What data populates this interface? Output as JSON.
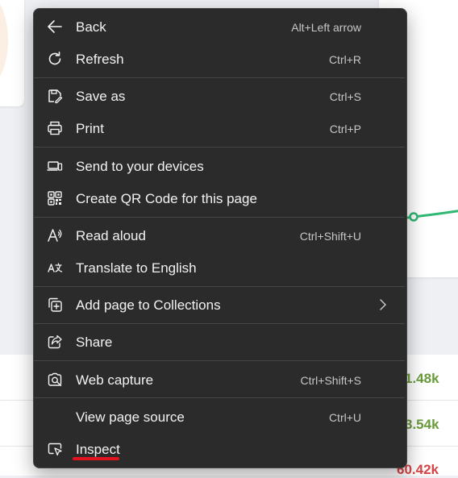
{
  "background": {
    "stat_values": [
      "1.48k",
      "3.54k",
      "60.42k"
    ],
    "stat_colors": [
      "#6a9b3a",
      "#6a9b3a",
      "#d64545"
    ],
    "chart_line_color": "#2eb872"
  },
  "menu": {
    "items": [
      {
        "label": "Back",
        "shortcut": "Alt+Left arrow",
        "icon": "back-arrow-icon"
      },
      {
        "label": "Refresh",
        "shortcut": "Ctrl+R",
        "icon": "refresh-icon"
      },
      {
        "label": "Save as",
        "shortcut": "Ctrl+S",
        "icon": "save-as-icon"
      },
      {
        "label": "Print",
        "shortcut": "Ctrl+P",
        "icon": "print-icon"
      },
      {
        "label": "Send to your devices",
        "shortcut": "",
        "icon": "send-to-devices-icon"
      },
      {
        "label": "Create QR Code for this page",
        "shortcut": "",
        "icon": "qr-code-icon"
      },
      {
        "label": "Read aloud",
        "shortcut": "Ctrl+Shift+U",
        "icon": "read-aloud-icon"
      },
      {
        "label": "Translate to English",
        "shortcut": "",
        "icon": "translate-icon"
      },
      {
        "label": "Add page to Collections",
        "shortcut": "",
        "icon": "collections-icon",
        "submenu": true
      },
      {
        "label": "Share",
        "shortcut": "",
        "icon": "share-icon"
      },
      {
        "label": "Web capture",
        "shortcut": "Ctrl+Shift+S",
        "icon": "web-capture-icon"
      },
      {
        "label": "View page source",
        "shortcut": "Ctrl+U",
        "icon": ""
      },
      {
        "label": "Inspect",
        "shortcut": "",
        "icon": "inspect-icon"
      }
    ]
  },
  "colors": {
    "menu_bg": "#2b2b2b",
    "menu_text": "#f2f2f2",
    "shortcut_text": "#c7c7c7",
    "separator": "#474747",
    "highlight_underline": "#e0141e"
  }
}
